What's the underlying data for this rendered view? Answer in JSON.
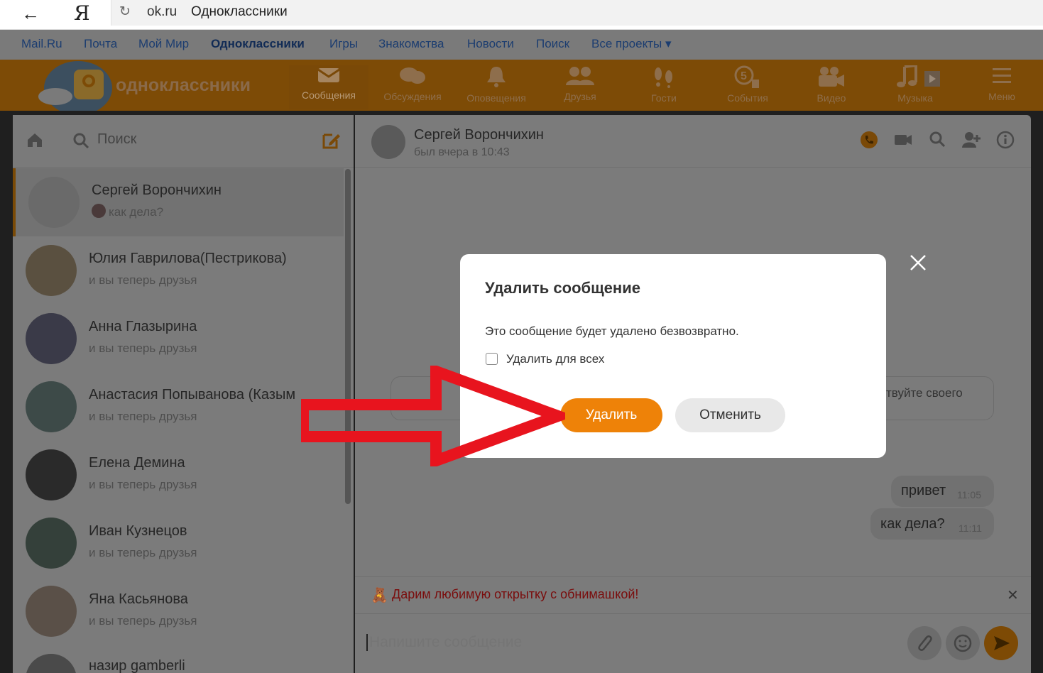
{
  "browser": {
    "back_icon": "arrow-left-icon",
    "logo": "Я",
    "domain": "ok.ru",
    "title": "Одноклассники"
  },
  "portal_nav": [
    {
      "label": "Mail.Ru"
    },
    {
      "label": "Почта"
    },
    {
      "label": "Мой Мир"
    },
    {
      "label": "Одноклассники",
      "active": true
    },
    {
      "label": "Игры"
    },
    {
      "label": "Знакомства"
    },
    {
      "label": "Новости"
    },
    {
      "label": "Поиск"
    },
    {
      "label": "Все проекты ▾"
    }
  ],
  "toolbar": {
    "logo_text": "одноклассники",
    "items": [
      {
        "label": "Сообщения",
        "icon": "envelope-icon"
      },
      {
        "label": "Обсуждения",
        "icon": "chat-bubbles-icon"
      },
      {
        "label": "Оповещения",
        "icon": "bell-icon"
      },
      {
        "label": "Друзья",
        "icon": "friends-icon"
      },
      {
        "label": "Гости",
        "icon": "footprints-icon"
      },
      {
        "label": "События",
        "icon": "events-icon",
        "badge": "5"
      },
      {
        "label": "Видео",
        "icon": "video-camera-icon"
      },
      {
        "label": "Музыка",
        "icon": "music-note-icon"
      },
      {
        "label": "Меню",
        "icon": "hamburger-icon"
      }
    ]
  },
  "sidebar": {
    "search_label": "Поиск",
    "chats": [
      {
        "name": "Сергей Ворончихин",
        "preview": "как дела?",
        "selected": true
      },
      {
        "name": "Юлия Гаврилова(Пестрикова)",
        "preview": "и вы теперь друзья"
      },
      {
        "name": "Анна Глазырина",
        "preview": "и вы теперь друзья"
      },
      {
        "name": "Анастасия Попыванова (Казым",
        "preview": "и вы теперь друзья"
      },
      {
        "name": "Елена Демина",
        "preview": "и вы теперь друзья"
      },
      {
        "name": "Иван Кузнецов",
        "preview": "и вы теперь друзья"
      },
      {
        "name": "Яна Касьянова",
        "preview": "и вы теперь друзья"
      },
      {
        "name": "назир gamberli",
        "preview": ""
      }
    ]
  },
  "conversation": {
    "peer_name": "Сергей Ворончихин",
    "peer_status": "был вчера в 10:43",
    "system_text": "твуйте своего",
    "messages": [
      {
        "text": "привет",
        "time": "11:05"
      },
      {
        "text": "как дела?",
        "time": "11:11"
      }
    ],
    "promo_text": "Дарим любимую открытку с обнимашкой!",
    "composer_placeholder": "Напишите сообщение"
  },
  "modal": {
    "title": "Удалить сообщение",
    "body": "Это сообщение будет удалено безвозвратно.",
    "checkbox_label": "Удалить для всех",
    "checkbox_checked": false,
    "delete_label": "Удалить",
    "cancel_label": "Отменить"
  },
  "colors": {
    "accent": "#ee8208",
    "arrow": "#e8141e"
  }
}
